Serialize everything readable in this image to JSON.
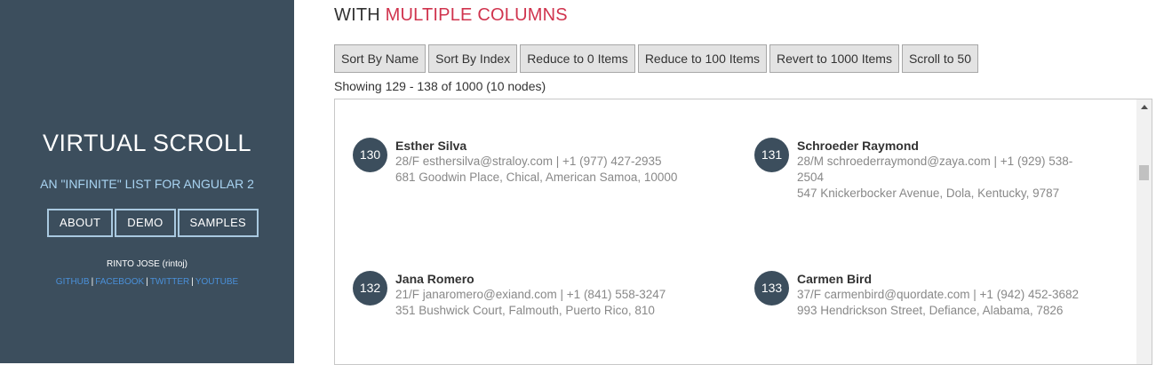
{
  "sidebar": {
    "title": "VIRTUAL SCROLL",
    "subtitle": "AN \"INFINITE\" LIST FOR ANGULAR 2",
    "nav": [
      "ABOUT",
      "DEMO",
      "SAMPLES"
    ],
    "author": "RINTO JOSE (rintoj)",
    "links": [
      "GITHUB",
      "FACEBOOK",
      "TWITTER",
      "YOUTUBE"
    ],
    "link_separator": "|"
  },
  "main": {
    "heading_prefix": "WITH",
    "heading_accent": "MULTIPLE COLUMNS",
    "toolbar": [
      "Sort By Name",
      "Sort By Index",
      "Reduce to 0 Items",
      "Reduce to 100 Items",
      "Revert to 1000 Items",
      "Scroll to 50"
    ],
    "status": "Showing 129 - 138 of 1000 (10 nodes)",
    "items": [
      {
        "index": "130",
        "name": "Esther Silva",
        "contact": "28/F esthersilva@straloy.com | +1 (977) 427-2935",
        "address": "681 Goodwin Place, Chical, American Samoa, 10000"
      },
      {
        "index": "131",
        "name": "Schroeder Raymond",
        "contact": "28/M schroederraymond@zaya.com | +1 (929) 538-2504",
        "address": "547 Knickerbocker Avenue, Dola, Kentucky, 9787"
      },
      {
        "index": "132",
        "name": "Jana Romero",
        "contact": "21/F janaromero@exiand.com | +1 (841) 558-3247",
        "address": "351 Bushwick Court, Falmouth, Puerto Rico, 810"
      },
      {
        "index": "133",
        "name": "Carmen Bird",
        "contact": "37/F carmenbird@quordate.com | +1 (942) 452-3682",
        "address": "993 Hendrickson Street, Defiance, Alabama, 7826"
      }
    ]
  },
  "colors": {
    "sidebar_bg": "#3c4e5d",
    "accent": "#d0344e",
    "link": "#4a90d9",
    "subtitle": "#a9d4f2"
  }
}
